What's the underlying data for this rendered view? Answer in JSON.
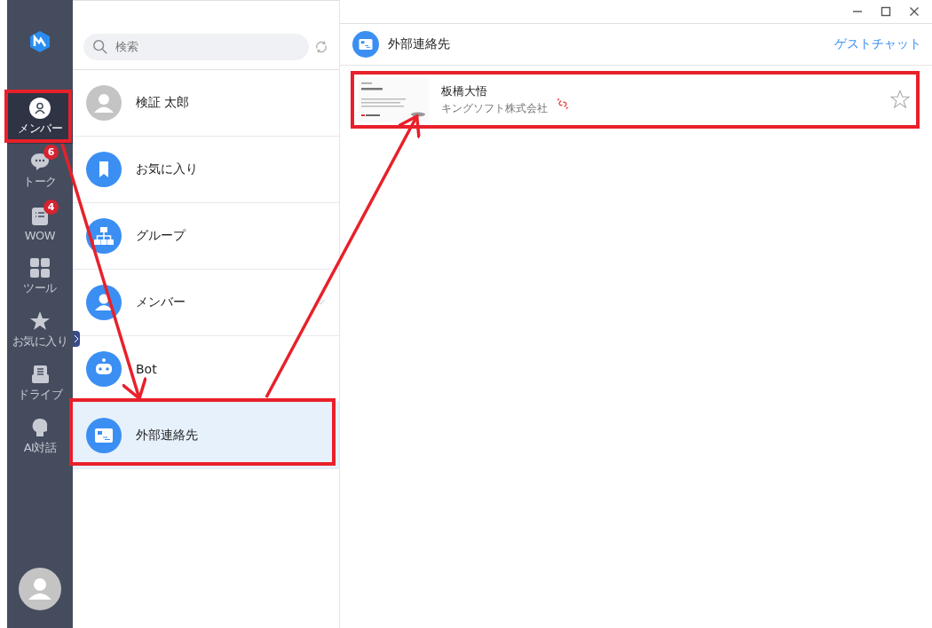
{
  "sidebar": {
    "items": [
      {
        "kind": "member",
        "label": "メンバー",
        "selected": true
      },
      {
        "kind": "talk",
        "label": "トーク",
        "selected": false,
        "badge": "6"
      },
      {
        "kind": "wow",
        "label": "WOW",
        "selected": false,
        "badge": "4"
      },
      {
        "kind": "tools",
        "label": "ツール",
        "selected": false
      },
      {
        "kind": "star",
        "label": "お気に入り",
        "selected": false
      },
      {
        "kind": "drive",
        "label": "ドライブ",
        "selected": false
      },
      {
        "kind": "ai",
        "label": "AI対話",
        "selected": false
      }
    ]
  },
  "search": {
    "placeholder": "検索"
  },
  "list": [
    {
      "kind": "person",
      "label": "検証 太郎",
      "selected": false
    },
    {
      "kind": "bookmark",
      "label": "お気に入り",
      "selected": false
    },
    {
      "kind": "org",
      "label": "グループ",
      "selected": false
    },
    {
      "kind": "member",
      "label": "メンバー",
      "selected": false,
      "expandable": true
    },
    {
      "kind": "bot",
      "label": "Bot",
      "selected": false
    },
    {
      "kind": "card",
      "label": "外部連絡先",
      "selected": true
    }
  ],
  "pane": {
    "title": "外部連絡先",
    "link": "ゲストチャット",
    "contacts": [
      {
        "name": "板橋大悟",
        "company": "キングソフト株式会社",
        "unlinked": true,
        "starred": false
      }
    ]
  }
}
